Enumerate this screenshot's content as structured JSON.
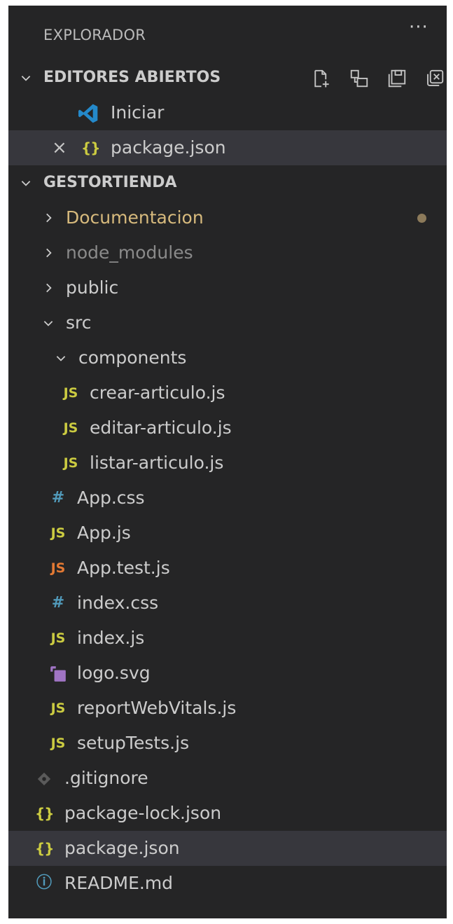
{
  "explorer": {
    "title": "EXPLORADOR",
    "more": "···"
  },
  "open_editors": {
    "header": "EDITORES ABIERTOS",
    "items": [
      {
        "label": "Iniciar",
        "icon": "vscode-icon"
      },
      {
        "label": "package.json",
        "icon": "json-icon",
        "close": "×"
      }
    ]
  },
  "workspace": {
    "header": "GESTORTIENDA",
    "items": [
      {
        "label": "Documentacion",
        "icon": "chevron-right-icon"
      },
      {
        "label": "node_modules",
        "icon": "chevron-right-icon"
      },
      {
        "label": "public",
        "icon": "chevron-right-icon"
      },
      {
        "label": "src",
        "icon": "chevron-down-icon"
      },
      {
        "label": "components",
        "icon": "chevron-down-icon"
      },
      {
        "label": "crear-articulo.js",
        "icon_text": "JS"
      },
      {
        "label": "editar-articulo.js",
        "icon_text": "JS"
      },
      {
        "label": "listar-articulo.js",
        "icon_text": "JS"
      },
      {
        "label": "App.css",
        "icon_text": "#"
      },
      {
        "label": "App.js",
        "icon_text": "JS"
      },
      {
        "label": "App.test.js",
        "icon_text": "JS"
      },
      {
        "label": "index.css",
        "icon_text": "#"
      },
      {
        "label": "index.js",
        "icon_text": "JS"
      },
      {
        "label": "logo.svg",
        "icon": "svg-file-icon"
      },
      {
        "label": "reportWebVitals.js",
        "icon_text": "JS"
      },
      {
        "label": "setupTests.js",
        "icon_text": "JS"
      },
      {
        "label": ".gitignore",
        "icon": "git-icon"
      },
      {
        "label": "package-lock.json",
        "icon_text": "{}"
      },
      {
        "label": "package.json",
        "icon_text": "{}"
      },
      {
        "label": "README.md",
        "icon_text": "ⓘ"
      }
    ]
  },
  "colors": {
    "background": "#252526",
    "selected_row": "#37373d",
    "js_icon": "#cbcb41",
    "test_icon": "#e37933",
    "css_icon": "#519aba",
    "modified_folder": "#d7ba7d"
  }
}
